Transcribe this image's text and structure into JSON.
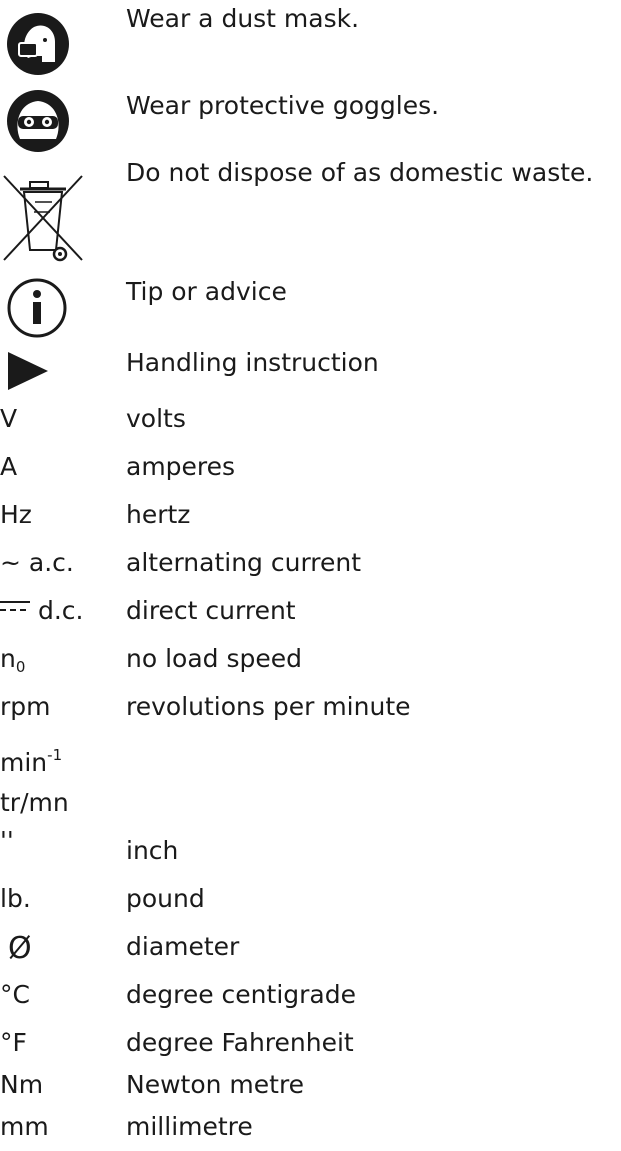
{
  "icon_legend": [
    {
      "icon": "dust-mask-icon",
      "text": "Wear a dust mask."
    },
    {
      "icon": "goggles-icon",
      "text": "Wear protective goggles."
    },
    {
      "icon": "crossed-bin-icon",
      "text": "Do not dispose of as domestic waste."
    },
    {
      "icon": "info-icon",
      "text": "Tip or advice"
    },
    {
      "icon": "play-arrow-icon",
      "text": "Handling instruction"
    }
  ],
  "units": [
    {
      "symbol": "V",
      "meaning": "volts"
    },
    {
      "symbol": "A",
      "meaning": "amperes"
    },
    {
      "symbol": "Hz",
      "meaning": "hertz"
    },
    {
      "symbol": "~ a.c.",
      "meaning": "alternating current"
    },
    {
      "symbol": "d.c.",
      "meaning": "direct current"
    },
    {
      "symbol": "n",
      "symbol_sub": "0",
      "meaning": "no load speed"
    },
    {
      "symbol": "rpm",
      "meaning": "revolutions per minute"
    },
    {
      "symbol": "min",
      "symbol_sup": "-1",
      "meaning": ""
    },
    {
      "symbol": "tr/mn",
      "meaning": ""
    },
    {
      "symbol": "''",
      "meaning": "inch"
    },
    {
      "symbol": "lb.",
      "meaning": "pound"
    },
    {
      "symbol": "Ø",
      "meaning": "diameter"
    },
    {
      "symbol": "°C",
      "meaning": "degree centigrade"
    },
    {
      "symbol": "°F",
      "meaning": "degree Fahrenheit"
    },
    {
      "symbol": "Nm",
      "meaning": "Newton metre"
    },
    {
      "symbol": "mm",
      "meaning": "millimetre"
    }
  ]
}
